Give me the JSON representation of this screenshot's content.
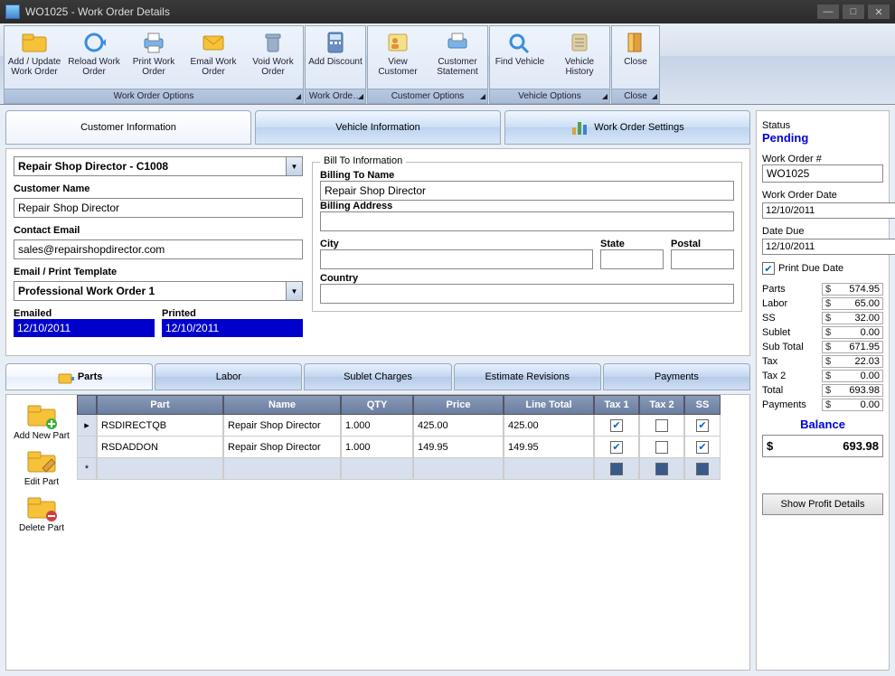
{
  "window": {
    "title": "WO1025 - Work Order Details"
  },
  "ribbon": {
    "groups": [
      {
        "label": "Work Order Options",
        "buttons": [
          "Add / Update Work Order",
          "Reload Work Order",
          "Print Work Order",
          "Email Work Order",
          "Void Work Order"
        ]
      },
      {
        "label": "Work Orde…",
        "buttons": [
          "Add Discount"
        ]
      },
      {
        "label": "Customer Options",
        "buttons": [
          "View Customer",
          "Customer Statement"
        ]
      },
      {
        "label": "Vehicle Options",
        "buttons": [
          "Find Vehicle",
          "Vehicle History"
        ]
      },
      {
        "label": "Close",
        "buttons": [
          "Close"
        ]
      }
    ]
  },
  "tabs": [
    "Customer Information",
    "Vehicle Information",
    "Work Order Settings"
  ],
  "customer": {
    "selector": "Repair Shop Director - C1008",
    "name_label": "Customer Name",
    "name": "Repair Shop Director",
    "email_label": "Contact Email",
    "email": "sales@repairshopdirector.com",
    "template_label": "Email / Print Template",
    "template": "Professional Work Order 1",
    "emailed_label": "Emailed",
    "emailed": "12/10/2011",
    "printed_label": "Printed",
    "printed": "12/10/2011"
  },
  "billto": {
    "legend": "Bill To Information",
    "name_label": "Billing To Name",
    "name": "Repair Shop Director",
    "address_label": "Billing Address",
    "address": "",
    "city_label": "City",
    "city": "",
    "state_label": "State",
    "state": "",
    "postal_label": "Postal",
    "postal": "",
    "country_label": "Country",
    "country": ""
  },
  "subtabs": [
    "Parts",
    "Labor",
    "Sublet Charges",
    "Estimate Revisions",
    "Payments"
  ],
  "parts_actions": {
    "add": "Add New Part",
    "edit": "Edit Part",
    "del": "Delete Part"
  },
  "grid": {
    "headers": [
      "Part",
      "Name",
      "QTY",
      "Price",
      "Line Total",
      "Tax 1",
      "Tax 2",
      "SS"
    ],
    "rows": [
      {
        "part": "RSDIRECTQB",
        "name": "Repair Shop Director",
        "qty": "1.000",
        "price": "425.00",
        "total": "425.00",
        "tax1": true,
        "tax2": false,
        "ss": true
      },
      {
        "part": "RSDADDON",
        "name": "Repair Shop Director",
        "qty": "1.000",
        "price": "149.95",
        "total": "149.95",
        "tax1": true,
        "tax2": false,
        "ss": true
      }
    ]
  },
  "side": {
    "status_label": "Status",
    "status": "Pending",
    "wo_label": "Work Order #",
    "wo": "WO1025",
    "date_label": "Work Order Date",
    "date": "12/10/2011",
    "due_label": "Date Due",
    "due": "12/10/2011",
    "print_due": "Print Due Date",
    "totals": [
      {
        "l": "Parts",
        "v": "574.95"
      },
      {
        "l": "Labor",
        "v": "65.00"
      },
      {
        "l": "SS",
        "v": "32.00"
      },
      {
        "l": "Sublet",
        "v": "0.00"
      },
      {
        "l": "Sub Total",
        "v": "671.95"
      },
      {
        "l": "Tax",
        "v": "22.03"
      },
      {
        "l": "Tax 2",
        "v": "0.00"
      },
      {
        "l": "Total",
        "v": "693.98"
      },
      {
        "l": "Payments",
        "v": "0.00"
      }
    ],
    "balance_label": "Balance",
    "balance": "693.98",
    "profit_btn": "Show Profit Details"
  }
}
